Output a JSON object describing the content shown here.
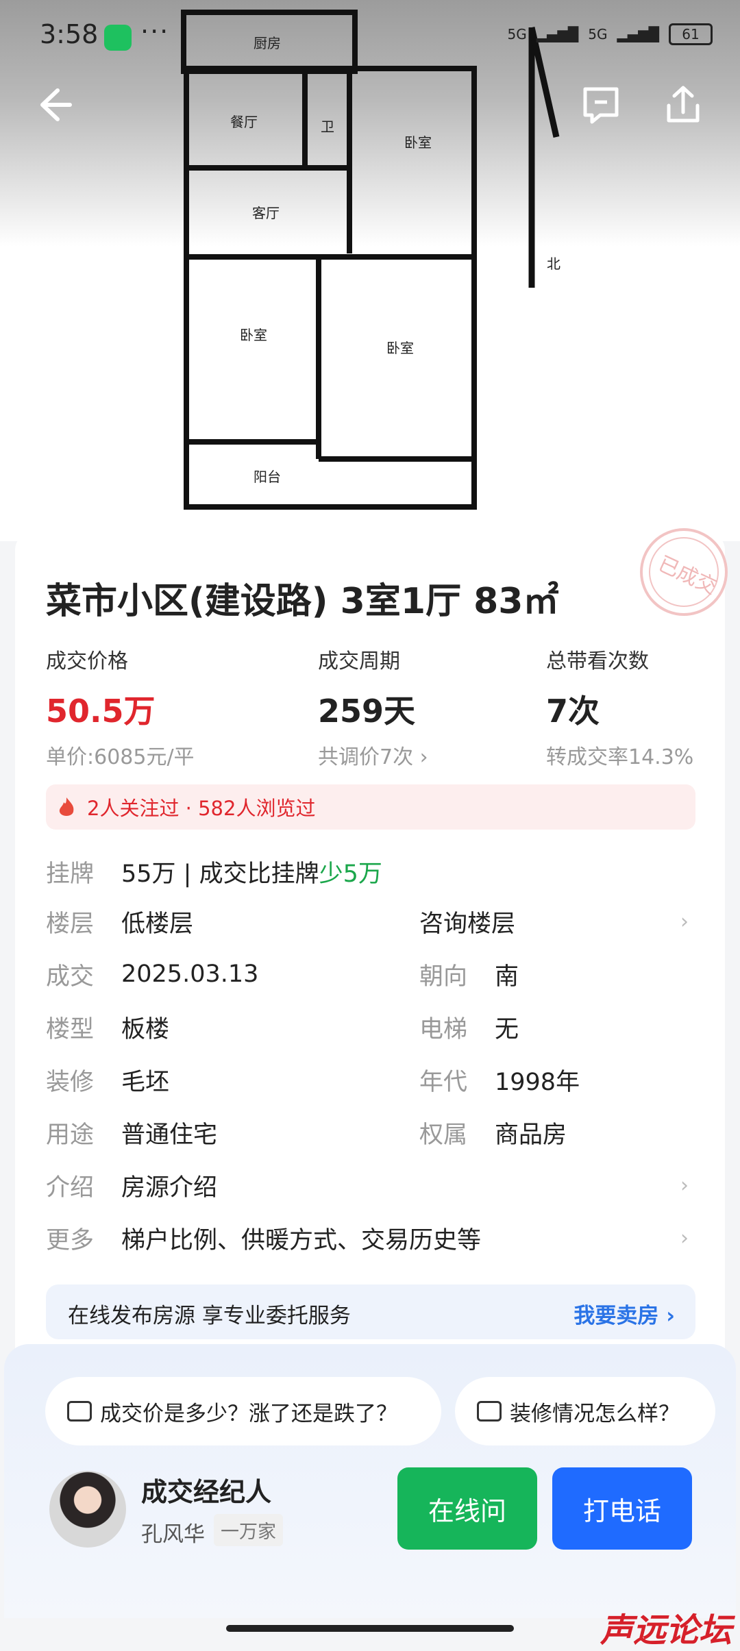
{
  "status_bar": {
    "time": "3:58",
    "dots": "···",
    "signal1": "5G",
    "signal2": "5G",
    "battery": "61"
  },
  "floorplan": {
    "rooms": [
      "厨房",
      "餐厅",
      "卫",
      "卧室",
      "客厅",
      "卧室",
      "卧室",
      "阳台"
    ],
    "north_label": "北"
  },
  "listing": {
    "title": "菜市小区(建设路) 3室1厅 83㎡",
    "stamp_text": "已成交",
    "stats": [
      {
        "label": "成交价格",
        "value": "50.5万",
        "sub": "单价:6085元/平"
      },
      {
        "label": "成交周期",
        "value": "259天",
        "sub": "共调价7次 ›"
      },
      {
        "label": "总带看次数",
        "value": "7次",
        "sub": "转成交率14.3%"
      }
    ],
    "attention": "2人关注过 · 582人浏览过",
    "listing_row": {
      "key": "挂牌",
      "value": "55万 | 成交比挂牌",
      "diff": "少5万"
    },
    "rows": [
      {
        "k": "楼层",
        "v": "低楼层",
        "k2": "",
        "v2": "咨询楼层",
        "chev": "›"
      },
      {
        "k": "成交",
        "v": "2025.03.13",
        "k2": "朝向",
        "v2": "南"
      },
      {
        "k": "楼型",
        "v": "板楼",
        "k2": "电梯",
        "v2": "无"
      },
      {
        "k": "装修",
        "v": "毛坯",
        "k2": "年代",
        "v2": "1998年"
      },
      {
        "k": "用途",
        "v": "普通住宅",
        "k2": "权属",
        "v2": "商品房"
      },
      {
        "k": "介绍",
        "v": "房源介绍",
        "chev": "›"
      },
      {
        "k": "更多",
        "v": "梯户比例、供暖方式、交易历史等",
        "chev": "›"
      }
    ],
    "sell_banner": {
      "text": "在线发布房源 享专业委托服务",
      "action": "我要卖房 ›"
    }
  },
  "bottom_panel": {
    "questions": [
      "成交价是多少？涨了还是跌了？",
      "装修情况怎么样？"
    ],
    "agent_role": "成交经纪人",
    "agent_name": "孔风华",
    "agent_tag": "一万家",
    "btn_online": "在线问",
    "btn_call": "打电话",
    "colors": {
      "online": "#16b55a",
      "call": "#1f6bff"
    }
  },
  "watermark": "声远论坛"
}
